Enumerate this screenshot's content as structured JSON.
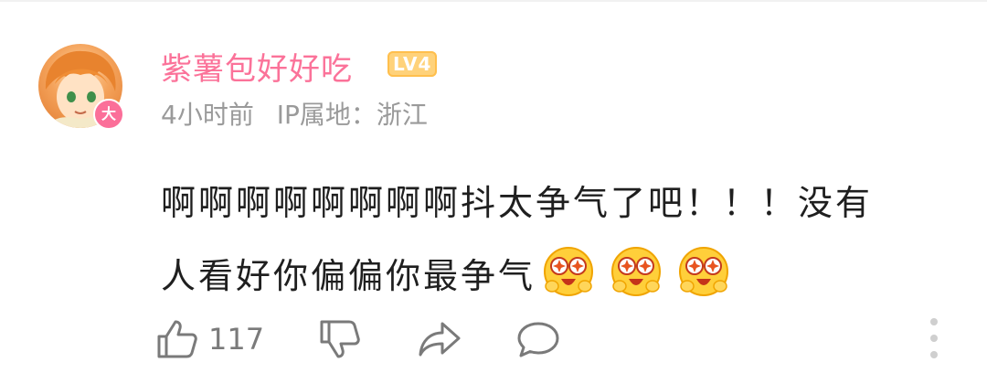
{
  "comment": {
    "username": "紫薯包好好吃",
    "level": "LV4",
    "avatar_badge": "大",
    "time": "4小时前",
    "ip_location": "IP属地：浙江",
    "text_line1": "啊啊啊啊啊啊啊啊抖太争气了吧！！！没有",
    "text_line2": "人看好你偏偏你最争气",
    "emojis": [
      "starry-eyed-emoji",
      "starry-eyed-emoji",
      "starry-eyed-emoji"
    ],
    "like_count": "117"
  },
  "icons": {
    "like": "thumbs-up-icon",
    "dislike": "thumbs-down-icon",
    "share": "share-arrow-icon",
    "reply": "comment-bubble-icon",
    "more": "more-vertical-icon"
  },
  "colors": {
    "username": "#fb7299",
    "level_badge": "#ffd27a",
    "meta_text": "#9a9a9a",
    "body_text": "#1f1f1f",
    "icon_gray": "#7a7a7a"
  }
}
